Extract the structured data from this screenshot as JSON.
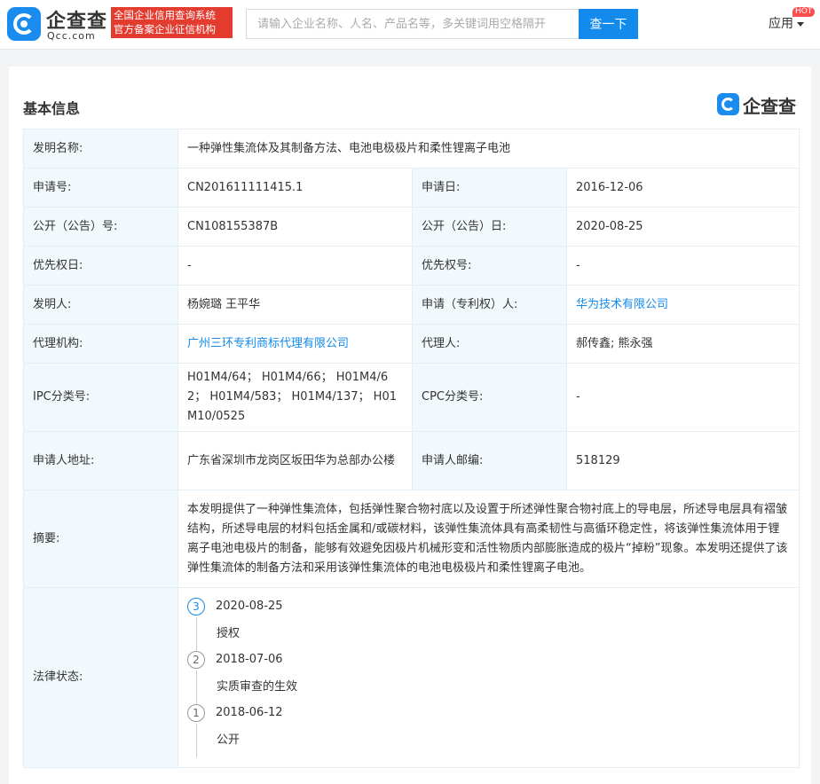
{
  "header": {
    "logo_name": "企查查",
    "logo_domain": "Qcc.com",
    "slogan_line1": "全国企业信用查询系统",
    "slogan_line2": "官方备案企业征信机构",
    "search_placeholder": "请输入企业名称、人名、产品名等，多关键词用空格隔开",
    "search_button": "查一下",
    "apps_label": "应用",
    "hot_badge": "HOT"
  },
  "section": {
    "title": "基本信息",
    "brand": "企查查"
  },
  "fields": {
    "invention_name_label": "发明名称:",
    "invention_name": "一种弹性集流体及其制备方法、电池电极极片和柔性锂离子电池",
    "app_no_label": "申请号:",
    "app_no": "CN201611111415.1",
    "app_date_label": "申请日:",
    "app_date": "2016-12-06",
    "pub_no_label": "公开（公告）号:",
    "pub_no": "CN108155387B",
    "pub_date_label": "公开（公告）日:",
    "pub_date": "2020-08-25",
    "priority_date_label": "优先权日:",
    "priority_date": "-",
    "priority_no_label": "优先权号:",
    "priority_no": "-",
    "inventor_label": "发明人:",
    "inventor": "杨婉璐 王平华",
    "applicant_label": "申请（专利权）人:",
    "applicant": "华为技术有限公司",
    "agency_label": "代理机构:",
    "agency": "广州三环专利商标代理有限公司",
    "agent_label": "代理人:",
    "agent": "郝传鑫; 熊永强",
    "ipc_label": "IPC分类号:",
    "ipc": "H01M4/64； H01M4/66； H01M4/62； H01M4/583； H01M4/137； H01M10/0525",
    "cpc_label": "CPC分类号:",
    "cpc": "-",
    "address_label": "申请人地址:",
    "address": "广东省深圳市龙岗区坂田华为总部办公楼",
    "postcode_label": "申请人邮编:",
    "postcode": "518129",
    "abstract_label": "摘要:",
    "abstract": "本发明提供了一种弹性集流体，包括弹性聚合物衬底以及设置于所述弹性聚合物衬底上的导电层，所述导电层具有褶皱结构，所述导电层的材料包括金属和/或碳材料，该弹性集流体具有高柔韧性与高循环稳定性，将该弹性集流体用于锂离子电池电极片的制备，能够有效避免因极片机械形变和活性物质内部膨胀造成的极片“掉粉”现象。本发明还提供了该弹性集流体的制备方法和采用该弹性集流体的电池电极极片和柔性锂离子电池。",
    "legal_label": "法律状态:"
  },
  "legal_status": [
    {
      "num": "3",
      "date": "2020-08-25",
      "desc": "授权"
    },
    {
      "num": "2",
      "date": "2018-07-06",
      "desc": "实质审查的生效"
    },
    {
      "num": "1",
      "date": "2018-06-12",
      "desc": "公开"
    }
  ],
  "colors": {
    "accent": "#128bed",
    "slogan_bg": "#e43b2f",
    "label_bg": "#f2f9fc"
  }
}
